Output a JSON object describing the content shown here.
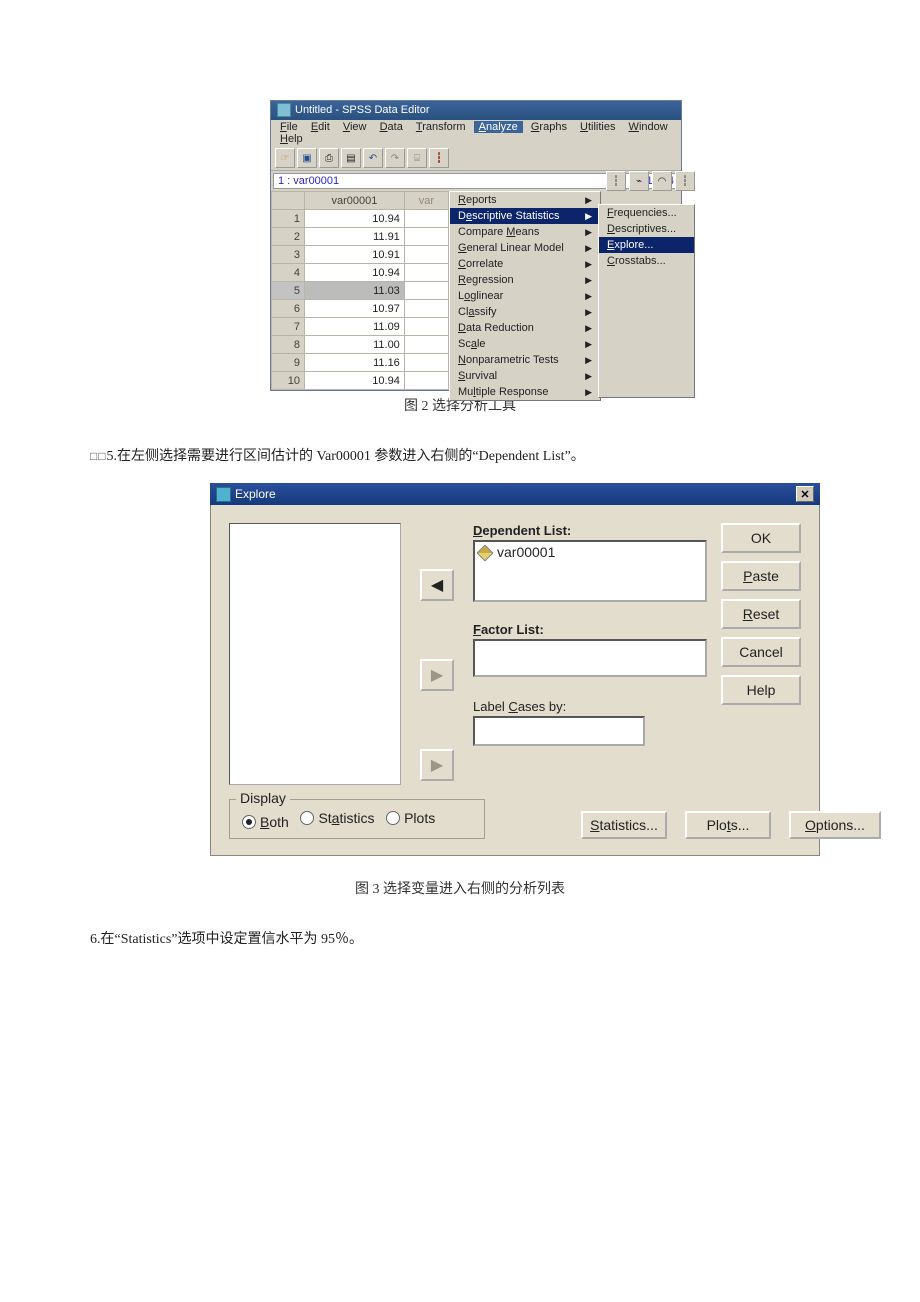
{
  "fig1": {
    "window_title": "Untitled - SPSS Data Editor",
    "menubar": {
      "file": "File",
      "edit": "Edit",
      "view": "View",
      "data": "Data",
      "transform": "Transform",
      "analyze": "Analyze",
      "graphs": "Graphs",
      "utilities": "Utilities",
      "window": "Window",
      "help": "Help"
    },
    "header_line": {
      "label": "1 : var00001",
      "value": "10.94"
    },
    "grid": {
      "col1": "var00001",
      "col2": "var",
      "rows": [
        {
          "n": "1",
          "v": "10.94"
        },
        {
          "n": "2",
          "v": "11.91"
        },
        {
          "n": "3",
          "v": "10.91"
        },
        {
          "n": "4",
          "v": "10.94"
        },
        {
          "n": "5",
          "v": "11.03"
        },
        {
          "n": "6",
          "v": "10.97"
        },
        {
          "n": "7",
          "v": "11.09"
        },
        {
          "n": "8",
          "v": "11.00"
        },
        {
          "n": "9",
          "v": "11.16"
        },
        {
          "n": "10",
          "v": "10.94"
        }
      ]
    },
    "analyze_menu": {
      "reports": "Reports",
      "descstat": "Descriptive Statistics",
      "compare": "Compare Means",
      "glm": "General Linear Model",
      "correlate": "Correlate",
      "regression": "Regression",
      "loglinear": "Loglinear",
      "classify": "Classify",
      "datared": "Data Reduction",
      "scale": "Scale",
      "nonpar": "Nonparametric Tests",
      "survival": "Survival",
      "multresp": "Multiple Response"
    },
    "desc_submenu": {
      "freq": "Frequencies...",
      "desc": "Descriptives...",
      "explore": "Explore...",
      "crosstabs": "Crosstabs..."
    },
    "caption": "图 2    选择分析工具"
  },
  "text1": "5.在左侧选择需要进行区间估计的 Var00001 参数进入右侧的“Dependent List”。",
  "fig2": {
    "title": "Explore",
    "labels": {
      "deplist": "Dependent List:",
      "deplist_item": "var00001",
      "factorlist": "Factor List:",
      "labelcases": "Label Cases by:"
    },
    "buttons": {
      "ok": "OK",
      "paste": "Paste",
      "reset": "Reset",
      "cancel": "Cancel",
      "help": "Help",
      "statistics": "Statistics...",
      "plots": "Plots...",
      "options": "Options..."
    },
    "display": {
      "legend": "Display",
      "both": "Both",
      "statistics": "Statistics",
      "plots": "Plots"
    },
    "caption": "图 3    选择变量进入右侧的分析列表"
  },
  "text2": "6.在“Statistics”选项中设定置信水平为 95％。"
}
